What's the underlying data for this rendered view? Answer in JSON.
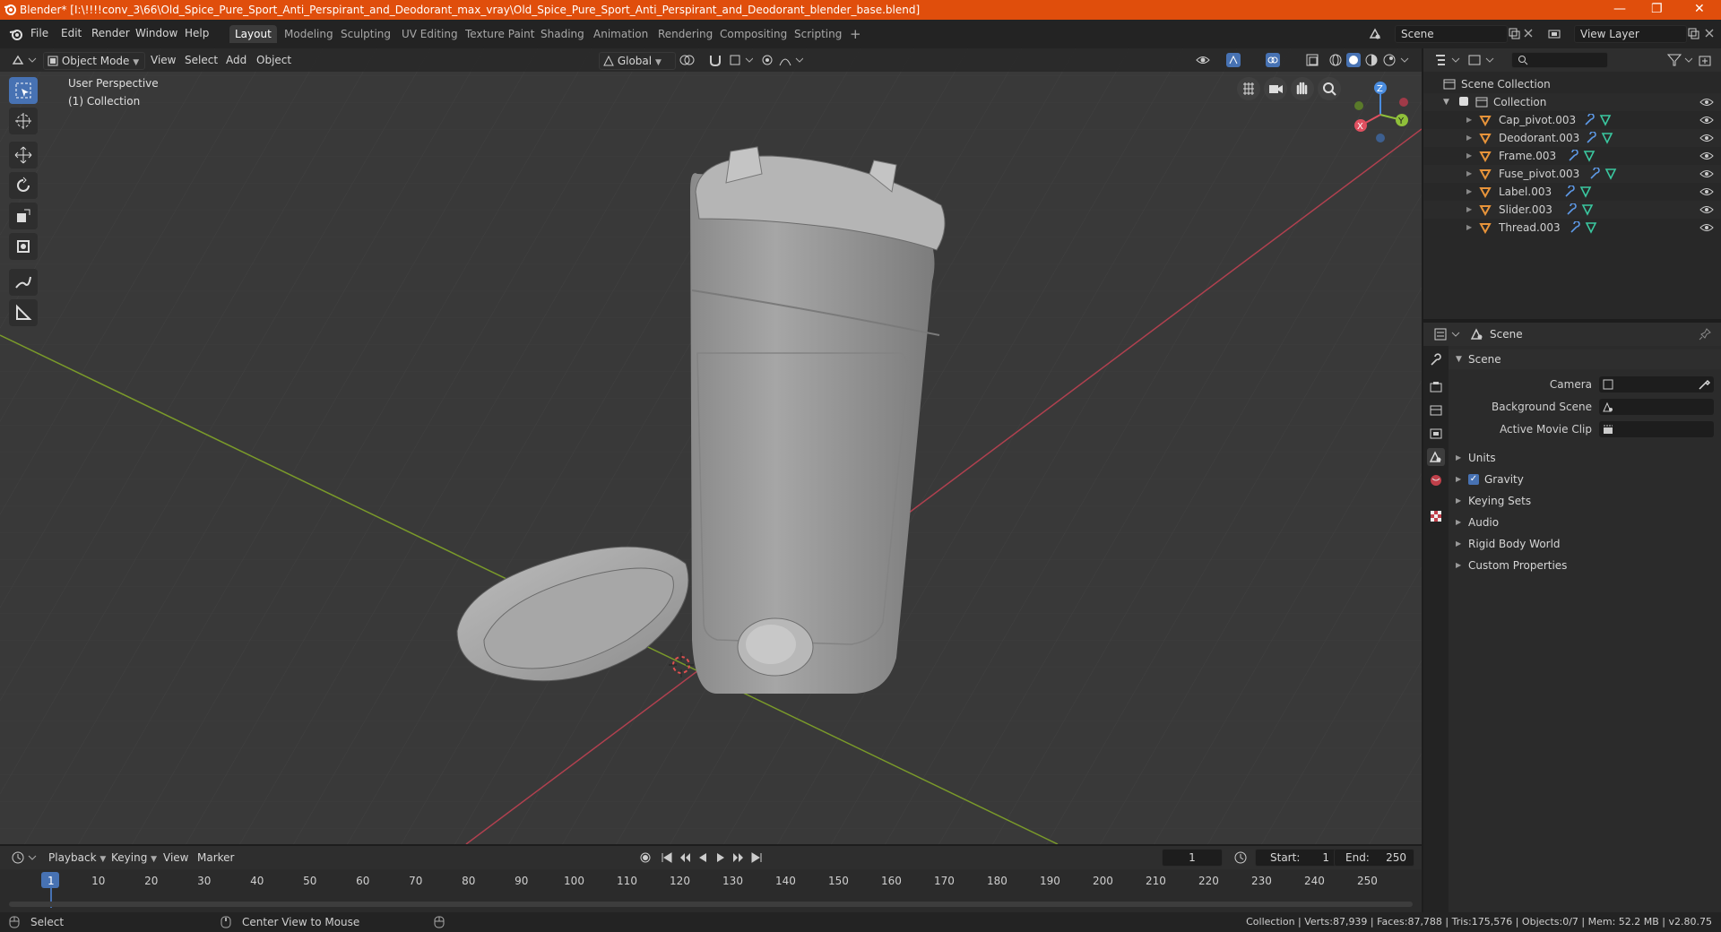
{
  "title_bar": {
    "title": "Blender* [I:\\!!!!conv_3\\66\\Old_Spice_Pure_Sport_Anti_Perspirant_and_Deodorant_max_vray\\Old_Spice_Pure_Sport_Anti_Perspirant_and_Deodorant_blender_base.blend]",
    "minimize": "—",
    "maximize": "❐",
    "close": "✕"
  },
  "menu": [
    "File",
    "Edit",
    "Render",
    "Window",
    "Help"
  ],
  "workspaces": [
    "Layout",
    "Modeling",
    "Sculpting",
    "UV Editing",
    "Texture Paint",
    "Shading",
    "Animation",
    "Rendering",
    "Compositing",
    "Scripting"
  ],
  "active_workspace": "Layout",
  "add_workspace": "+",
  "scene_field": "Scene",
  "view_layer_field": "View Layer",
  "viewport": {
    "mode": "Object Mode",
    "menus": [
      "View",
      "Select",
      "Add",
      "Object"
    ],
    "orientation": "Global",
    "overlay_line1": "User Perspective",
    "overlay_line2": "(1) Collection",
    "gizmo": {
      "x": "X",
      "y": "Y",
      "z": "Z"
    },
    "colors": {
      "x_axis": "#e05060",
      "y_axis": "#8fc03a",
      "z_axis": "#4a8de0"
    }
  },
  "outliner": {
    "search_placeholder": "",
    "root": "Scene Collection",
    "collection": "Collection",
    "items": [
      {
        "name": "Cap_pivot.003"
      },
      {
        "name": "Deodorant.003"
      },
      {
        "name": "Frame.003"
      },
      {
        "name": "Fuse_pivot.003"
      },
      {
        "name": "Label.003"
      },
      {
        "name": "Slider.003"
      },
      {
        "name": "Thread.003"
      }
    ]
  },
  "properties": {
    "header": "Scene",
    "section": "Scene",
    "fields": [
      {
        "label": "Camera"
      },
      {
        "label": "Background Scene"
      },
      {
        "label": "Active Movie Clip"
      }
    ],
    "panels": [
      "Units",
      "Gravity",
      "Keying Sets",
      "Audio",
      "Rigid Body World",
      "Custom Properties"
    ],
    "gravity_checked": true
  },
  "timeline": {
    "menus": [
      "Playback",
      "Keying",
      "View",
      "Marker"
    ],
    "current_frame": "1",
    "start_label": "Start:",
    "start": "1",
    "end_label": "End:",
    "end": "250",
    "ticks": [
      "1",
      "10",
      "20",
      "30",
      "40",
      "50",
      "60",
      "70",
      "80",
      "90",
      "100",
      "110",
      "120",
      "130",
      "140",
      "150",
      "160",
      "170",
      "180",
      "190",
      "200",
      "210",
      "220",
      "230",
      "240",
      "250"
    ]
  },
  "status": {
    "left": "Select",
    "middle": "Center View to Mouse",
    "right": "Collection | Verts:87,939 | Faces:87,788 | Tris:175,576 | Objects:0/7 | Mem: 52.2 MB | v2.80.75"
  }
}
